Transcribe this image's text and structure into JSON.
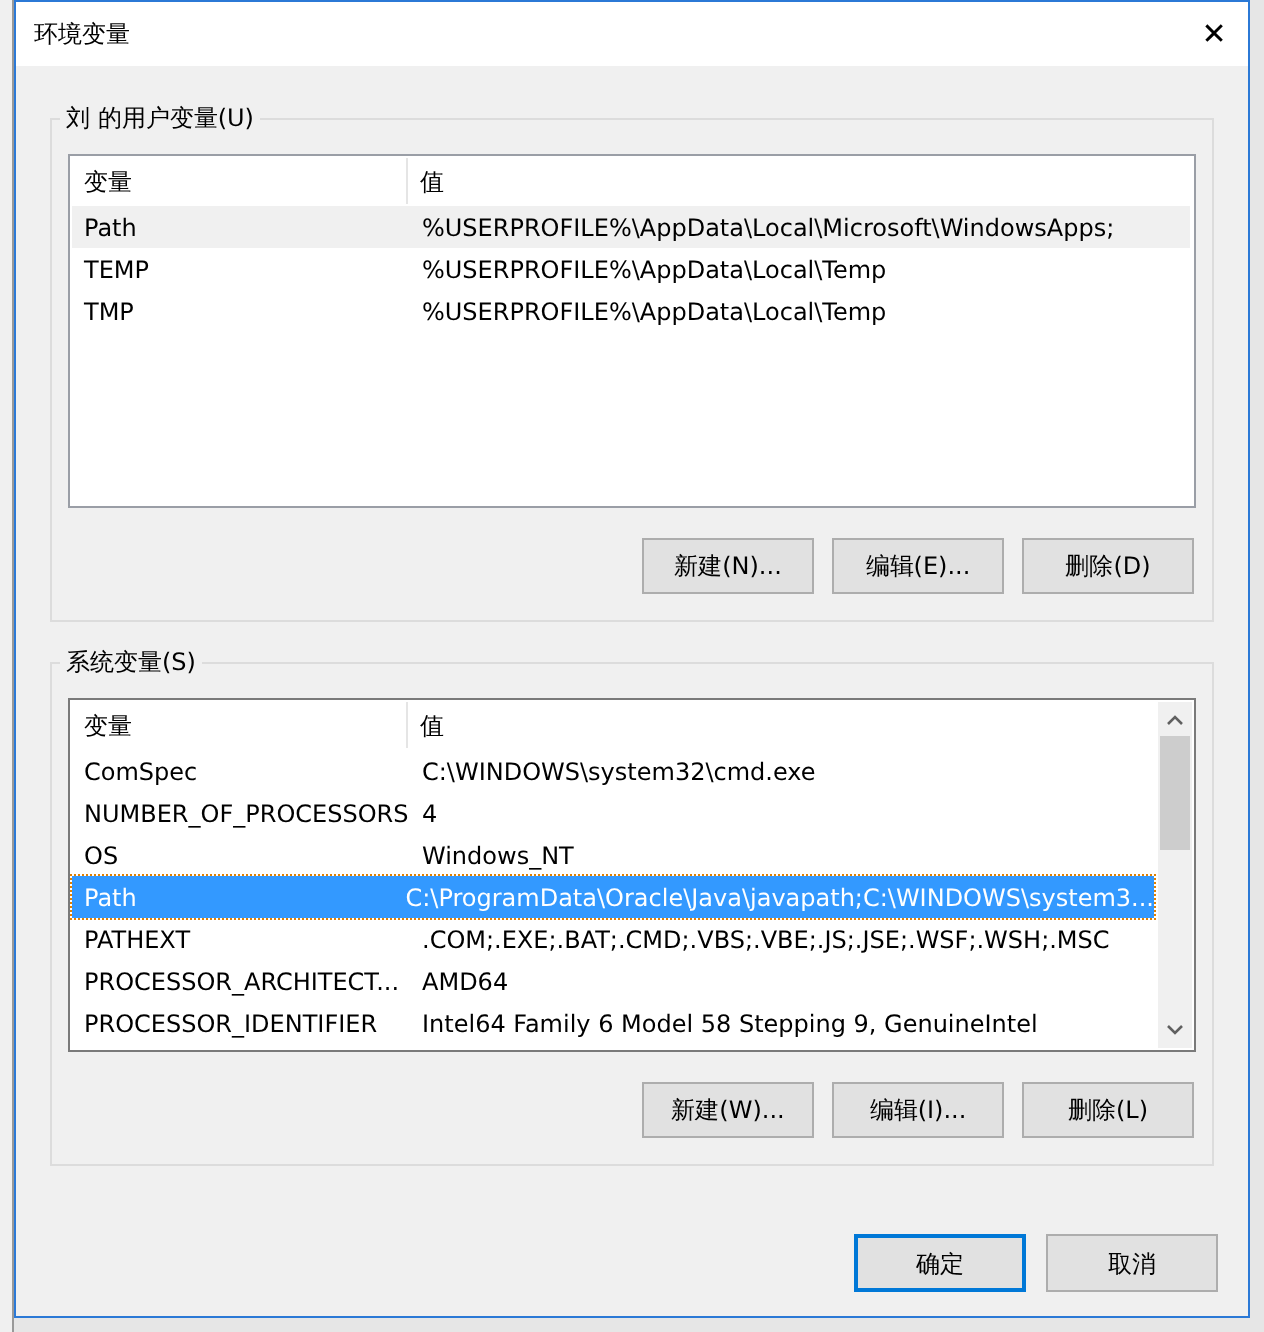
{
  "window": {
    "title": "环境变量",
    "close": "✕"
  },
  "user_variables": {
    "title": "刘 的用户变量(U)",
    "columns": [
      "变量",
      "值"
    ],
    "rows": [
      {
        "name": "Path",
        "value": "%USERPROFILE%\\AppData\\Local\\Microsoft\\WindowsApps;",
        "selected": true
      },
      {
        "name": "TEMP",
        "value": "%USERPROFILE%\\AppData\\Local\\Temp",
        "selected": false
      },
      {
        "name": "TMP",
        "value": "%USERPROFILE%\\AppData\\Local\\Temp",
        "selected": false
      }
    ],
    "focused": false,
    "buttons": [
      "新建(N)...",
      "编辑(E)...",
      "删除(D)"
    ]
  },
  "system_variables": {
    "title": "系统变量(S)",
    "columns": [
      "变量",
      "值"
    ],
    "rows": [
      {
        "name": "ComSpec",
        "value": "C:\\WINDOWS\\system32\\cmd.exe",
        "selected": false
      },
      {
        "name": "NUMBER_OF_PROCESSORS",
        "value": "4",
        "selected": false
      },
      {
        "name": "OS",
        "value": "Windows_NT",
        "selected": false
      },
      {
        "name": "Path",
        "value": "C:\\ProgramData\\Oracle\\Java\\javapath;C:\\WINDOWS\\system3...",
        "selected": true
      },
      {
        "name": "PATHEXT",
        "value": ".COM;.EXE;.BAT;.CMD;.VBS;.VBE;.JS;.JSE;.WSF;.WSH;.MSC",
        "selected": false
      },
      {
        "name": "PROCESSOR_ARCHITECT...",
        "value": "AMD64",
        "selected": false
      },
      {
        "name": "PROCESSOR_IDENTIFIER",
        "value": "Intel64 Family 6 Model 58 Stepping 9, GenuineIntel",
        "selected": false
      }
    ],
    "focused": true,
    "buttons": [
      "新建(W)...",
      "编辑(I)...",
      "删除(L)"
    ]
  },
  "dialog_buttons": [
    {
      "label": "确定",
      "default": true
    },
    {
      "label": "取消",
      "default": false
    }
  ]
}
